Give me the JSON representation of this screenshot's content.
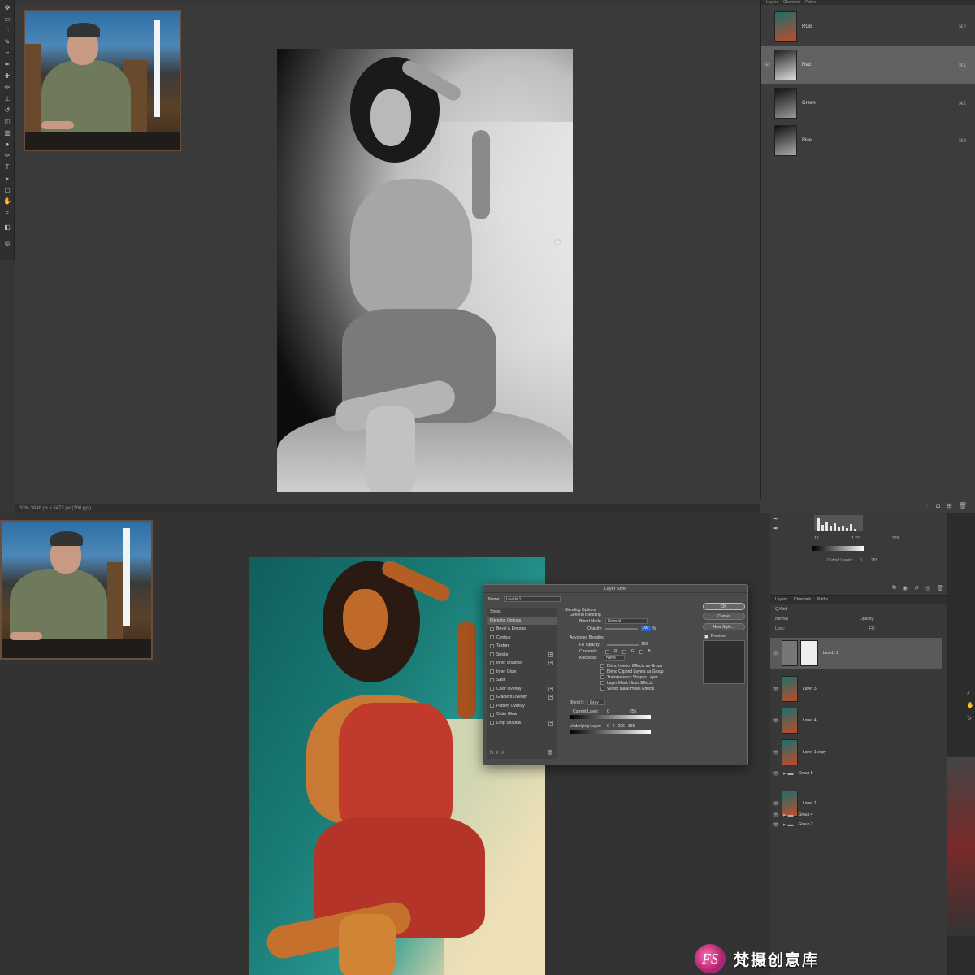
{
  "top": {
    "status_text": "33% 3648 px x 5472 px (300 ppi)",
    "channels_tabs": [
      "Layers",
      "Channels",
      "Paths"
    ],
    "channels": [
      {
        "name": "RGB",
        "shortcut": "⌘2",
        "selected": false,
        "visible": false
      },
      {
        "name": "Red",
        "shortcut": "⌘1",
        "selected": true,
        "visible": true
      },
      {
        "name": "Green",
        "shortcut": "⌘2",
        "selected": false,
        "visible": false
      },
      {
        "name": "Blue",
        "shortcut": "⌘3",
        "selected": false,
        "visible": false
      }
    ]
  },
  "bottom": {
    "levels": {
      "input_values": [
        "17",
        "1.27",
        "229"
      ],
      "output_label": "Output Levels:",
      "output_values": [
        "0",
        "255"
      ]
    },
    "layers_tabs": [
      "Layers",
      "Channels",
      "Paths"
    ],
    "layers_kind": "Q Kind",
    "layers_mode": "Normal",
    "layers_opacity": "Opacity:",
    "layers_lock": "Lock:",
    "layers_fill": "Fill:",
    "layers": [
      {
        "name": "Levels 1",
        "type": "adjustment",
        "selected": true
      },
      {
        "name": "Layer 3",
        "type": "image",
        "selected": false
      },
      {
        "name": "Layer 4",
        "type": "image",
        "selected": false
      },
      {
        "name": "Layer 1 copy",
        "type": "image",
        "selected": false
      },
      {
        "name": "Group 5",
        "type": "group",
        "selected": false
      },
      {
        "name": "Layer 1",
        "type": "image",
        "selected": false
      },
      {
        "name": "Group 4",
        "type": "group",
        "selected": false
      },
      {
        "name": "Group 2",
        "type": "group",
        "selected": false
      }
    ],
    "dialog": {
      "title": "Layer Style",
      "name_label": "Name:",
      "name_value": "Levels 1",
      "styles_header": "Styles",
      "styles": [
        {
          "label": "Blending Options",
          "selected": true,
          "plus": false
        },
        {
          "label": "Bevel & Emboss",
          "selected": false,
          "plus": false
        },
        {
          "label": "Contour",
          "selected": false,
          "plus": false
        },
        {
          "label": "Texture",
          "selected": false,
          "plus": false
        },
        {
          "label": "Stroke",
          "selected": false,
          "plus": true
        },
        {
          "label": "Inner Shadow",
          "selected": false,
          "plus": true
        },
        {
          "label": "Inner Glow",
          "selected": false,
          "plus": false
        },
        {
          "label": "Satin",
          "selected": false,
          "plus": false
        },
        {
          "label": "Color Overlay",
          "selected": false,
          "plus": true
        },
        {
          "label": "Gradient Overlay",
          "selected": false,
          "plus": true
        },
        {
          "label": "Pattern Overlay",
          "selected": false,
          "plus": false
        },
        {
          "label": "Outer Glow",
          "selected": false,
          "plus": false
        },
        {
          "label": "Drop Shadow",
          "selected": false,
          "plus": true
        }
      ],
      "section_blending": "Blending Options",
      "section_general": "General Blending",
      "blend_mode_label": "Blend Mode:",
      "blend_mode_value": "Normal",
      "opacity_label": "Opacity:",
      "opacity_value": "100",
      "opacity_unit": "%",
      "section_advanced": "Advanced Blending",
      "fill_opacity_label": "Fill Opacity:",
      "fill_opacity_value": "100",
      "channels_label": "Channels:",
      "channel_r": "R",
      "channel_g": "G",
      "channel_b": "B",
      "knockout_label": "Knockout:",
      "knockout_value": "None",
      "options": [
        "Blend Interior Effects as Group",
        "Blend Clipped Layers as Group",
        "Transparency Shapes Layer",
        "Layer Mask Hides Effects",
        "Vector Mask Hides Effects"
      ],
      "blend_if_label": "Blend If:",
      "blend_if_value": "Gray",
      "current_layer_label": "Current Layer:",
      "current_layer_values": [
        "0",
        "255"
      ],
      "underlying_label": "Underlying Layer:",
      "underlying_values": [
        "0",
        "2",
        "226",
        "255"
      ],
      "ok": "OK",
      "cancel": "Cancel",
      "new_style": "New Style...",
      "preview": "Preview"
    }
  },
  "watermark": {
    "logo_text": "FS",
    "text": "梵摄创意库"
  }
}
